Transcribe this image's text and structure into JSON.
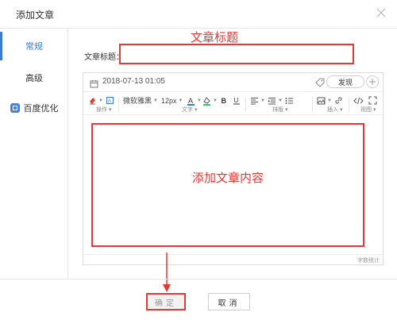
{
  "dialog": {
    "title": "添加文章"
  },
  "sidebar": {
    "items": [
      {
        "label": "常规",
        "active": true
      },
      {
        "label": "高级",
        "active": false
      },
      {
        "label": "百度优化",
        "active": false,
        "icon": "seo-badge-icon"
      }
    ]
  },
  "form": {
    "title_label": "文章标题：",
    "title_value": "",
    "title_placeholder": ""
  },
  "editor": {
    "date": "2018-07-13 01:05",
    "publish_label": "发现",
    "toolbar": {
      "font_family": "微软雅黑",
      "font_size": "12px",
      "groups": [
        "操作",
        "文字",
        "排版",
        "插入",
        "视图"
      ]
    },
    "word_count_label": "字数统计"
  },
  "annotations": {
    "title_hint": "文章标题",
    "content_hint": "添加文章内容",
    "color": "#e53935"
  },
  "footer": {
    "ok_label": "确定",
    "cancel_label": "取消"
  },
  "colors": {
    "accent": "#3a7bd5",
    "highlight": "#e53935",
    "border": "#dcdcdc"
  }
}
